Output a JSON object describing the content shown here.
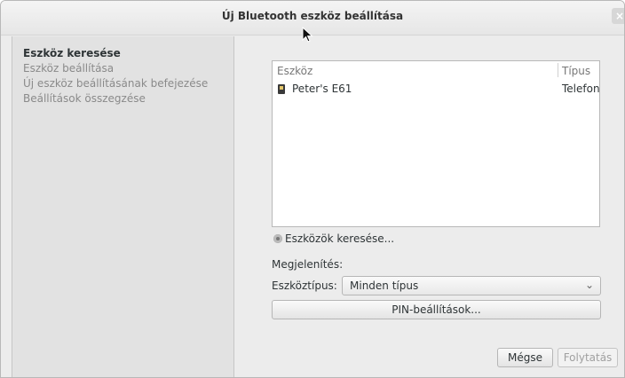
{
  "window": {
    "title": "Új Bluetooth eszköz beállítása",
    "close_glyph": "×"
  },
  "sidebar": {
    "items": [
      {
        "label": "Eszköz keresése",
        "active": true
      },
      {
        "label": "Eszköz beállítása",
        "active": false
      },
      {
        "label": "Új eszköz beállításának befejezése",
        "active": false
      },
      {
        "label": "Beállítások összegzése",
        "active": false
      }
    ]
  },
  "device_list": {
    "columns": [
      "Eszköz",
      "Típus"
    ],
    "rows": [
      {
        "name": "Peter's E61",
        "type": "Telefon",
        "icon": "phone-icon"
      }
    ]
  },
  "search_status": "Eszközök keresése...",
  "display_section": {
    "heading": "Megjelenítés:",
    "device_type_label": "Eszköztípus:",
    "device_type_value": "Minden típus"
  },
  "buttons": {
    "pin": "PIN-beállítások...",
    "cancel": "Mégse",
    "continue": "Folytatás"
  }
}
